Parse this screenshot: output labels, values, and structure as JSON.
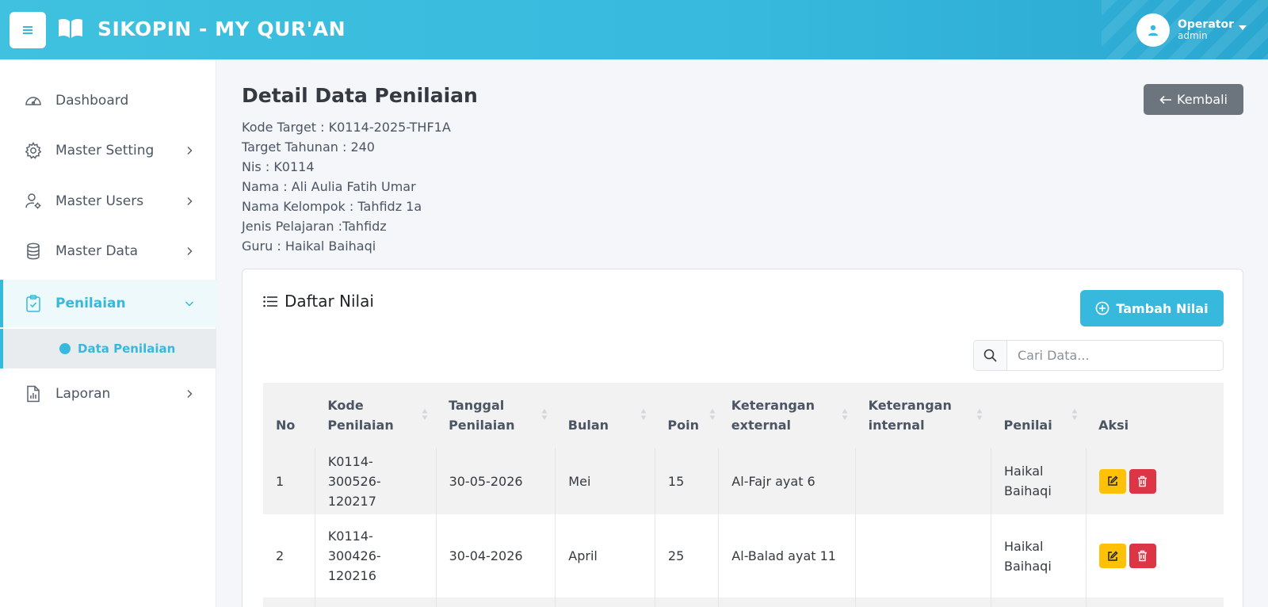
{
  "header": {
    "app_title": "SIKOPIN - MY QUR'AN",
    "user_name": "Operator",
    "user_role": "admin"
  },
  "sidebar": {
    "items": [
      {
        "label": "Dashboard",
        "icon": "dashboard-gauge-icon"
      },
      {
        "label": "Master Setting",
        "icon": "gear-icon"
      },
      {
        "label": "Master Users",
        "icon": "user-cog-icon"
      },
      {
        "label": "Master Data",
        "icon": "database-icon"
      },
      {
        "label": "Penilaian",
        "icon": "clipboard-check-icon",
        "active": true
      },
      {
        "label": "Laporan",
        "icon": "report-chart-icon"
      }
    ],
    "sub_items": [
      {
        "label": "Data Penilaian",
        "active": true
      }
    ]
  },
  "page": {
    "title": "Detail Data Penilaian",
    "back_label": "Kembali",
    "details": [
      "Kode Target : K0114-2025-THF1A",
      "Target Tahunan : 240",
      "Nis : K0114",
      "Nama : Ali Aulia Fatih Umar",
      "Nama Kelompok : Tahfidz 1a",
      "Jenis Pelajaran :Tahfidz",
      "Guru : Haikal Baihaqi"
    ]
  },
  "card": {
    "title": "Daftar Nilai",
    "add_label": "Tambah Nilai",
    "search_placeholder": "Cari Data..."
  },
  "table": {
    "headers": [
      "No",
      "Kode Penilaian",
      "Tanggal Penilaian",
      "Bulan",
      "Poin",
      "Keterangan external",
      "Keterangan internal",
      "Penilai",
      "Aksi"
    ],
    "rows": [
      {
        "no": "1",
        "kode": "K0114-300526-120217",
        "tanggal": "30-05-2026",
        "bulan": "Mei",
        "poin": "15",
        "ket_ext": "Al-Fajr ayat 6",
        "ket_int": "",
        "penilai": "Haikal Baihaqi"
      },
      {
        "no": "2",
        "kode": "K0114-300426-120216",
        "tanggal": "30-04-2026",
        "bulan": "April",
        "poin": "25",
        "ket_ext": "Al-Balad ayat 11",
        "ket_int": "",
        "penilai": "Haikal Baihaqi"
      }
    ]
  },
  "colors": {
    "accent": "#36b9dd",
    "secondary_button": "#6c757d",
    "edit_button": "#ffc107",
    "delete_button": "#dc3545"
  }
}
